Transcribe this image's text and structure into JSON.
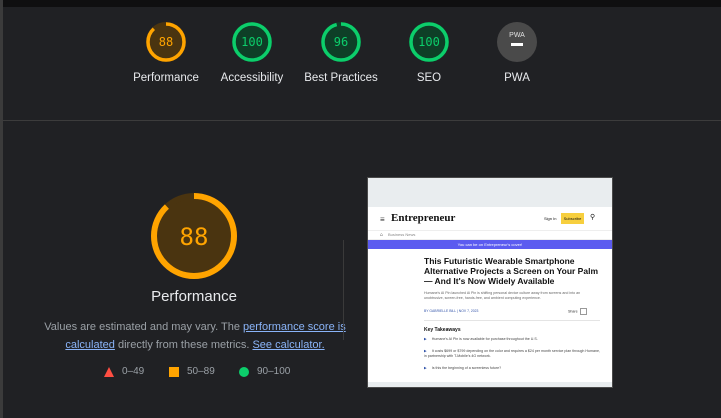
{
  "gauges": [
    {
      "label": "Performance",
      "score": "88",
      "color": "#ffa400",
      "fill": 0.88,
      "bg": "#4a3410"
    },
    {
      "label": "Accessibility",
      "score": "100",
      "color": "#0cce6b",
      "fill": 1.0,
      "bg": "#0e3f27"
    },
    {
      "label": "Best Practices",
      "score": "96",
      "color": "#0cce6b",
      "fill": 0.96,
      "bg": "#0e3f27"
    },
    {
      "label": "SEO",
      "score": "100",
      "color": "#0cce6b",
      "fill": 1.0,
      "bg": "#0e3f27"
    },
    {
      "label": "PWA",
      "score": "PWA",
      "color": "#bdbdbd",
      "fill": 0,
      "bg": "#4a4a4a"
    }
  ],
  "main": {
    "score": "88",
    "title": "Performance",
    "fill": 0.88,
    "color": "#ffa400",
    "bg": "#4a3410",
    "note_prefix": "Values are estimated and may vary. The ",
    "note_link1": "performance score is calculated",
    "note_mid": " directly from these metrics. ",
    "note_link2": "See calculator."
  },
  "legend": [
    {
      "range": "0–49",
      "shape": "triangle",
      "color": "#ff4e42"
    },
    {
      "range": "50–89",
      "shape": "square",
      "color": "#ffa400"
    },
    {
      "range": "90–100",
      "shape": "circle",
      "color": "#0cce6b"
    }
  ],
  "screenshot": {
    "brand": "Entrepreneur",
    "signin": "Sign In",
    "subscribe": "Subscribe",
    "crumb": "Business News",
    "banner": "You can be on Entrepreneur's cover!",
    "headline": "This Futuristic Wearable Smartphone Alternative Projects a Screen on Your Palm — And It's Now Widely Available",
    "subhead": "Humane's AI Pin launched Ai Pin is shifting personal device culture away from screens and into an unobtrusive, screen-free, hands-free, and ambient computing experience.",
    "byline": "BY GABRIELLE BILL  |  NOV 7, 2023",
    "share": "Share",
    "key_takeaways_title": "Key Takeaways",
    "takeaways": [
      "Humane's AI Pin is now available for purchase throughout the U.S.",
      "It costs $699 or $799 depending on the color and requires a $24 per month service plan through Humane, in partnership with T-Mobile's 4G network.",
      "Is this the beginning of a screenless future?"
    ]
  }
}
